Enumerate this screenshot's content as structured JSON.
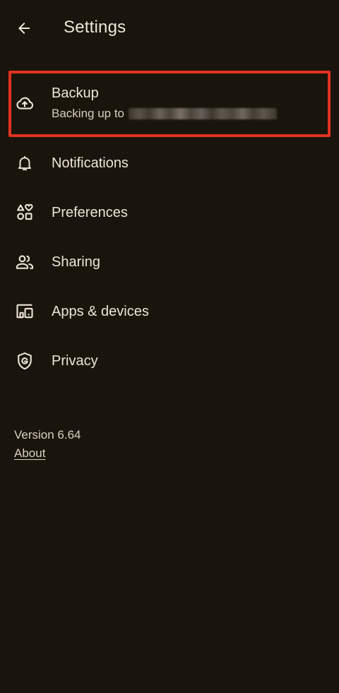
{
  "header": {
    "title": "Settings",
    "back_icon": "arrow-back-icon"
  },
  "settings": {
    "items": [
      {
        "label": "Backup",
        "sublabel": "Backing up to",
        "icon": "cloud-upload-icon"
      },
      {
        "label": "Notifications",
        "icon": "bell-icon"
      },
      {
        "label": "Preferences",
        "icon": "shapes-icon"
      },
      {
        "label": "Sharing",
        "icon": "people-icon"
      },
      {
        "label": "Apps & devices",
        "icon": "devices-icon"
      },
      {
        "label": "Privacy",
        "icon": "shield-g-icon"
      }
    ]
  },
  "footer": {
    "version": "Version 6.64",
    "about_label": "About"
  },
  "colors": {
    "background": "#1a150c",
    "text": "#ece5d8",
    "highlight": "#e0321f"
  }
}
